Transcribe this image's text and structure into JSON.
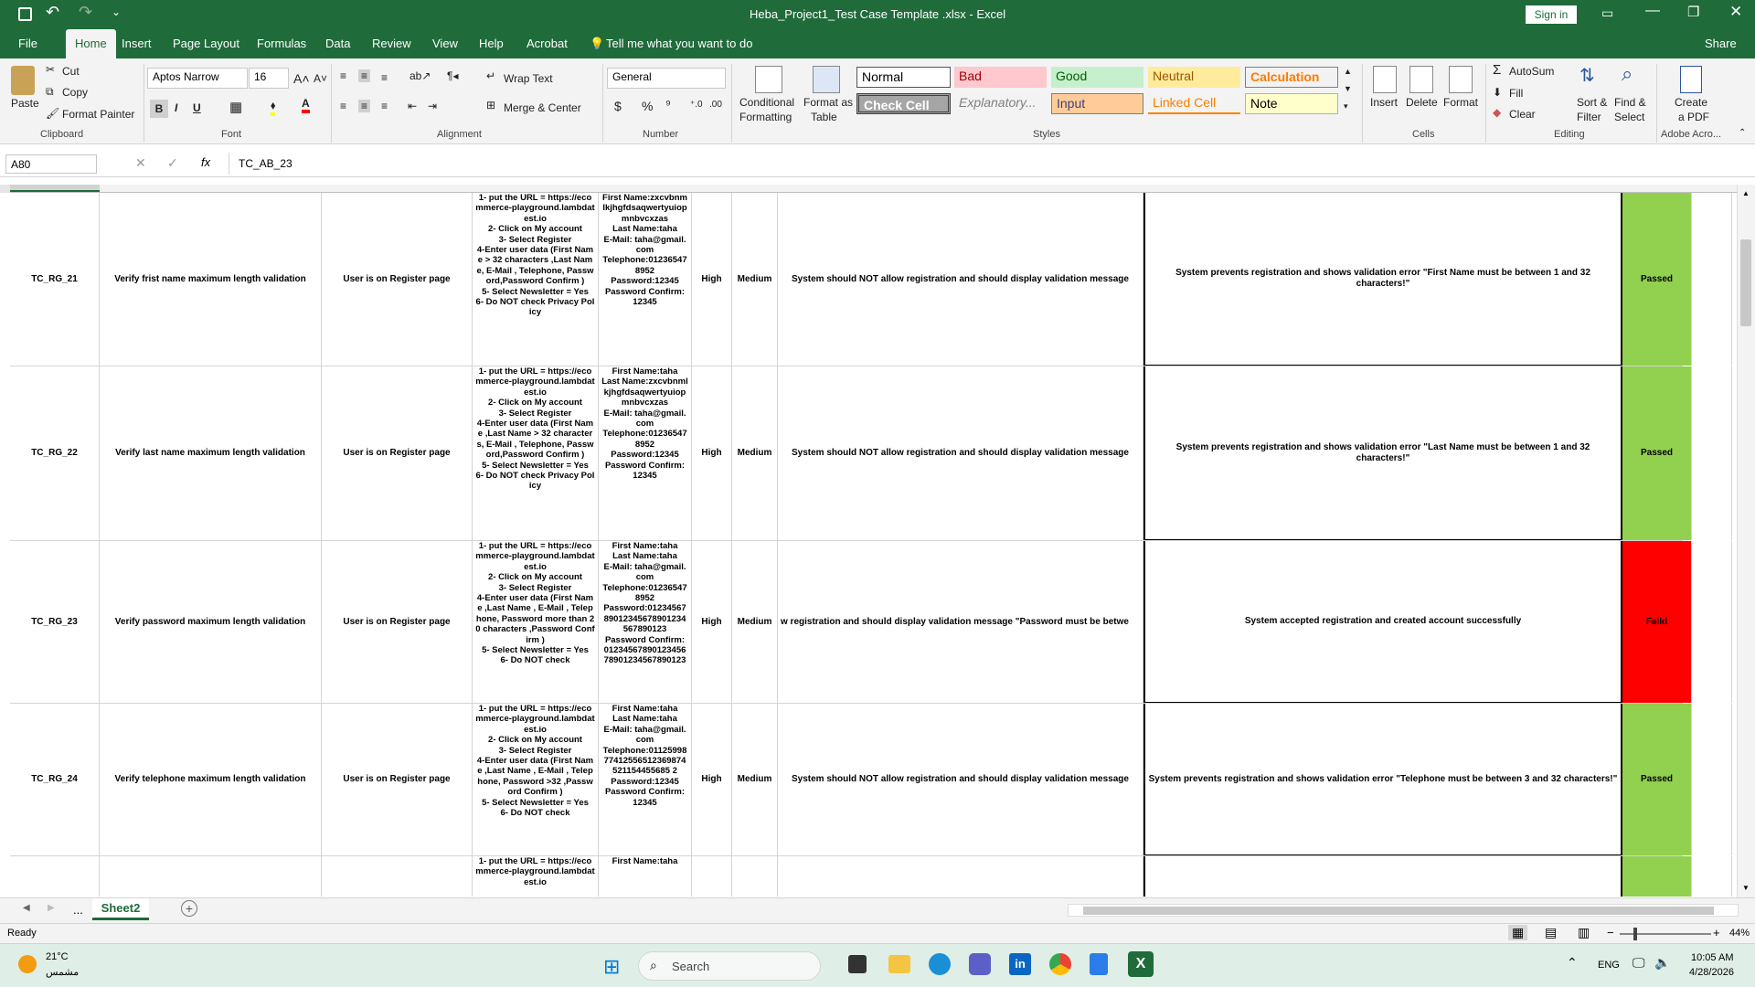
{
  "title_bar": {
    "title": "Heba_Project1_Test Case Template .xlsx  -  Excel",
    "sign_in": "Sign in"
  },
  "tabs": [
    "File",
    "Home",
    "Insert",
    "Page Layout",
    "Formulas",
    "Data",
    "Review",
    "View",
    "Help",
    "Acrobat"
  ],
  "tell_me": "Tell me what you want to do",
  "share": "Share",
  "clipboard": {
    "paste": "Paste",
    "cut": "Cut",
    "copy": "Copy",
    "format_painter": "Format Painter",
    "label": "Clipboard"
  },
  "font": {
    "name": "Aptos Narrow",
    "size": "16",
    "label": "Font"
  },
  "alignment": {
    "wrap": "Wrap Text",
    "merge": "Merge & Center",
    "label": "Alignment"
  },
  "number": {
    "format": "General",
    "label": "Number"
  },
  "styles": {
    "conditional": "Conditional",
    "conditional2": "Formatting",
    "format_table": "Format as",
    "format_table2": "Table",
    "normal": "Normal",
    "bad": "Bad",
    "good": "Good",
    "neutral": "Neutral",
    "calculation": "Calculation",
    "check_cell": "Check Cell",
    "explanatory": "Explanatory...",
    "input": "Input",
    "linked_cell": "Linked Cell",
    "note": "Note",
    "label": "Styles"
  },
  "cells_group": {
    "insert": "Insert",
    "delete": "Delete",
    "format": "Format",
    "label": "Cells"
  },
  "editing": {
    "autosum": "AutoSum",
    "fill": "Fill",
    "clear": "Clear",
    "sort": "Sort &",
    "sort2": "Filter",
    "find": "Find &",
    "find2": "Select",
    "label": "Editing"
  },
  "acrobat": {
    "create": "Create",
    "create2": "a PDF",
    "label": "Adobe Acro..."
  },
  "formula_bar": {
    "name_box": "A80",
    "fx": "fx",
    "value": "TC_AB_23"
  },
  "rows": [
    {
      "id": "TC_RG_21",
      "title": "Verify frist name maximum length validation",
      "pre": "User is on Register page",
      "steps": "1- put the URL = https://ecommerce-playground.lambdatest.io\n2- Click on My account\n3- Select Register\n4-Enter user data (First Name > 32 characters ,Last Name, E-Mail , Telephone, Password,Password Confirm )\n5- Select Newsletter = Yes\n6- Do NOT check Privacy Policy",
      "data": "First Name:zxcvbnmlkjhgfdsaqwertyuiopmnbvcxzas\nLast Name:taha\nE-Mail: taha@gmail.com\nTelephone:012365478952\nPassword:12345\nPassword Confirm: 12345",
      "priority": "High",
      "severity": "Medium",
      "expected": "System should NOT allow registration and should display validation message",
      "actual": "System prevents registration and shows validation error \"First Name must be between 1 and 32 characters!\"",
      "status": "Passed"
    },
    {
      "id": "TC_RG_22",
      "title": "Verify last name maximum length validation",
      "pre": "User is on Register page",
      "steps": "1- put the URL = https://ecommerce-playground.lambdatest.io\n2- Click on My account\n3- Select Register\n4-Enter user data (First Name ,Last Name > 32 characters, E-Mail , Telephone, Password,Password Confirm )\n5- Select Newsletter = Yes\n6- Do NOT check Privacy Policy",
      "data": "First Name:taha\nLast Name:zxcvbnmlkjhgfdsaqwertyuiopmnbvcxzas\nE-Mail: taha@gmail.com\nTelephone:012365478952\nPassword:12345\nPassword Confirm: 12345",
      "priority": "High",
      "severity": "Medium",
      "expected": "System should NOT allow registration and should display validation message",
      "actual": "System prevents registration and shows validation error \"Last Name must be between 1 and 32 characters!\"",
      "status": "Passed"
    },
    {
      "id": "TC_RG_23",
      "title": "Verify password maximum length validation",
      "pre": "User is on Register page",
      "steps": "1- put the URL = https://ecommerce-playground.lambdatest.io\n2- Click on My account\n3- Select Register\n4-Enter user data (First Name ,Last Name , E-Mail , Telephone, Password more than 20 characters ,Password Confirm )\n5- Select Newsletter = Yes\n6- Do NOT check",
      "data": "First Name:taha\nLast Name:taha\nE-Mail: taha@gmail.com\nTelephone:012365478952\nPassword:0123456789012345678901234567890123\nPassword Confirm: 0123456789012345678901234567890123",
      "priority": "High",
      "severity": "Medium",
      "expected": "w registration and should display validation message \"Password must be betwe",
      "actual": "System accepted registration and created account successfully",
      "status": "Faild"
    },
    {
      "id": "TC_RG_24",
      "title": "Verify telephone maximum length validation",
      "pre": "User is on Register page",
      "steps": "1- put the URL = https://ecommerce-playground.lambdatest.io\n2- Click on My account\n3- Select Register\n4-Enter user data (First Name ,Last Name , E-Mail , Telephone, Password >32 ,Password Confirm )\n5- Select Newsletter = Yes\n6- Do NOT check",
      "data": "First Name:taha\nLast Name:taha\nE-Mail: taha@gmail.com\nTelephone:0112599877412556512369874521154455685 2\nPassword:12345\nPassword Confirm: 12345",
      "priority": "High",
      "severity": "Medium",
      "expected": "System should NOT allow registration and should display validation message",
      "actual": "System prevents registration and shows validation error \"Telephone must be between 3 and 32 characters!\"",
      "status": "Passed"
    },
    {
      "id": "",
      "title": "",
      "pre": "",
      "steps": "1- put the URL = https://ecommerce-playground.lambdatest.io",
      "data": "First Name:taha",
      "priority": "",
      "severity": "",
      "expected": "",
      "actual": "",
      "status": ""
    }
  ],
  "colors": {
    "passed": "#92d050",
    "failed": "#ff0000",
    "excel_green": "#1f6b3a"
  },
  "sheet_tab": "Sheet2",
  "sheet_more": "...",
  "status": {
    "ready": "Ready",
    "zoom": "44%"
  },
  "taskbar": {
    "temp": "21°C",
    "weather": "مشمس",
    "search": "Search",
    "lang": "ENG",
    "time": "10:05 AM",
    "date": "4/28/2026"
  }
}
